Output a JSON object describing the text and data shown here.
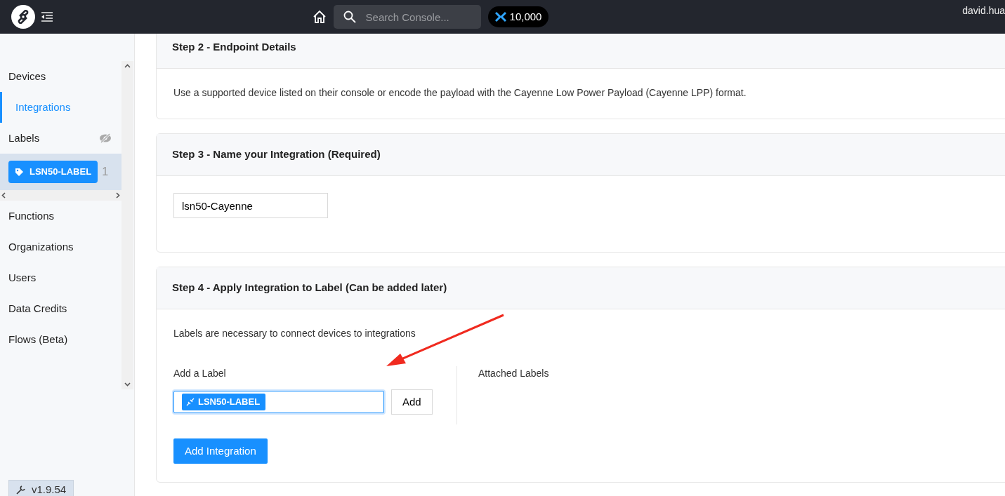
{
  "topbar": {
    "search": {
      "placeholder": "Search Console..."
    },
    "credits": "10,000",
    "user": "david.hua"
  },
  "sidebar": {
    "items": [
      {
        "kind": "link",
        "label": "Devices",
        "selected": false
      },
      {
        "kind": "link",
        "label": "Integrations",
        "selected": true
      },
      {
        "kind": "labels-header",
        "label": "Labels",
        "selected": false
      },
      {
        "kind": "label-tag",
        "label": "LSN50-LABEL",
        "count": "1",
        "selected": true
      },
      {
        "kind": "link",
        "label": "Functions",
        "selected": false
      },
      {
        "kind": "link",
        "label": "Organizations",
        "selected": false
      },
      {
        "kind": "link",
        "label": "Users",
        "selected": false
      },
      {
        "kind": "link",
        "label": "Data Credits",
        "selected": false
      },
      {
        "kind": "link",
        "label": "Flows (Beta)",
        "selected": false
      }
    ],
    "version": "v1.9.54"
  },
  "steps": [
    {
      "kind": "text",
      "title": "Step 2 - Endpoint Details",
      "text": "Use a supported device listed on their console or encode the payload with the Cayenne Low Power Payload (Cayenne LPP) format."
    },
    {
      "kind": "name",
      "title": "Step 3 - Name your Integration (Required)",
      "value": "lsn50-Cayenne"
    },
    {
      "kind": "labels",
      "title": "Step 4 - Apply Integration to Label (Can be added later)",
      "intro": "Labels are necessary to connect devices to integrations",
      "add_title": "Add a Label",
      "selected_label": "LSN50-LABEL",
      "add_button": "Add",
      "attached_title": "Attached Labels",
      "submit": "Add Integration"
    }
  ]
}
